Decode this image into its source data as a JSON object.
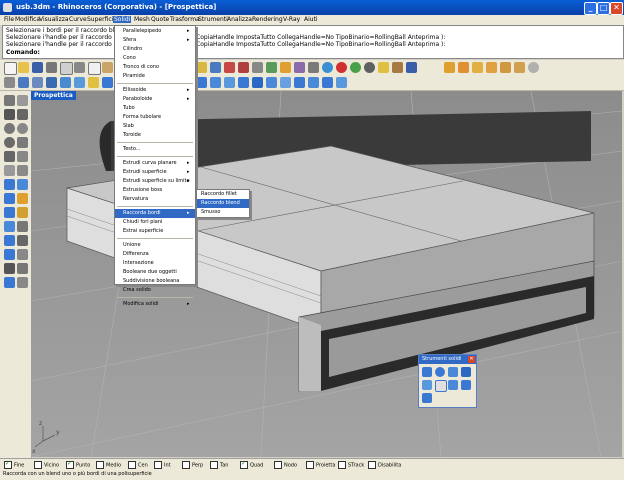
{
  "window": {
    "title": "usb.3dm - Rhinoceros (Corporativa) - [Prospettica]",
    "min_label": "_",
    "max_label": "□",
    "close_label": "✕"
  },
  "menubar": {
    "items": [
      "File",
      "Modifica",
      "Visualizza",
      "Curve",
      "Superfici",
      "Solidi",
      "Mesh",
      "Quote",
      "Trasforma",
      "Strumenti",
      "Analizza",
      "Rendering",
      "V-Ray",
      "Aiuti"
    ]
  },
  "command": {
    "lines": [
      "Selezionare i bordi per il raccordo blend",
      "Selezionare i'handle per il raccordo blend",
      "Selezionare i'handle per il raccordo blend"
    ],
    "right_text": "CopiaHandle ImpostaTutto CollegaHandle=No TipoBinario=RollingBall Anteprima ):",
    "prompt": "Comando:"
  },
  "viewport": {
    "label": "Prospettica",
    "axis_z": "z",
    "axis_y": "y",
    "axis_x": "x"
  },
  "dropdown": {
    "items": [
      {
        "label": "Parallelepipedo",
        "arrow": "▸"
      },
      {
        "label": "Sfera",
        "arrow": "▸"
      },
      {
        "label": "Cilindro",
        "arrow": ""
      },
      {
        "label": "Cono",
        "arrow": ""
      },
      {
        "label": "Tronco di cono",
        "arrow": ""
      },
      {
        "label": "Piramide",
        "arrow": ""
      },
      {
        "label": "Ellissoide",
        "arrow": "▸"
      },
      {
        "label": "Paraboloide",
        "arrow": "▸"
      },
      {
        "label": "Tubo",
        "arrow": ""
      },
      {
        "label": "Forma tubolare",
        "arrow": ""
      },
      {
        "label": "Slab",
        "arrow": ""
      },
      {
        "label": "Toroide",
        "arrow": ""
      },
      {
        "label": "Testo...",
        "arrow": ""
      },
      {
        "label": "Estrudi curva planare",
        "arrow": "▸"
      },
      {
        "label": "Estrudi superficie",
        "arrow": "▸"
      },
      {
        "label": "Estrudi superficie su limite",
        "arrow": "▸"
      },
      {
        "label": "Estrusione boss",
        "arrow": ""
      },
      {
        "label": "Nervatura",
        "arrow": ""
      },
      {
        "label": "Raccorda bordi",
        "arrow": "▸"
      },
      {
        "label": "Chiudi fori piani",
        "arrow": ""
      },
      {
        "label": "Estrai superficie",
        "arrow": ""
      },
      {
        "label": "Unione",
        "arrow": ""
      },
      {
        "label": "Differenza",
        "arrow": ""
      },
      {
        "label": "Intersezione",
        "arrow": ""
      },
      {
        "label": "Booleane due oggetti",
        "arrow": ""
      },
      {
        "label": "Suddivisione booleana",
        "arrow": ""
      },
      {
        "label": "Crea solido",
        "arrow": ""
      },
      {
        "label": "Modifica solidi",
        "arrow": "▸"
      }
    ],
    "highlighted": "Raccorda bordi"
  },
  "submenu": {
    "items": [
      "Raccordo fillet",
      "Raccordo blend",
      "Smusso"
    ],
    "highlighted": "Raccordo blend"
  },
  "palette": {
    "title": "Strumenti solidi",
    "close": "✕"
  },
  "osnap": [
    {
      "label": "Fine",
      "checked": true
    },
    {
      "label": "Vicino",
      "checked": false
    },
    {
      "label": "Punto",
      "checked": true
    },
    {
      "label": "Medio",
      "checked": false
    },
    {
      "label": "Cen",
      "checked": false
    },
    {
      "label": "Int",
      "checked": false
    },
    {
      "label": "Perp",
      "checked": false
    },
    {
      "label": "Tan",
      "checked": false
    },
    {
      "label": "Quad",
      "checked": true
    },
    {
      "label": "Nodo",
      "checked": false
    },
    {
      "label": "Proietta",
      "checked": false
    },
    {
      "label": "STrack",
      "checked": false
    },
    {
      "label": "Disabilita",
      "checked": false
    }
  ],
  "status": "Raccorda con un blend uno o più bordi di una polisuperficie"
}
